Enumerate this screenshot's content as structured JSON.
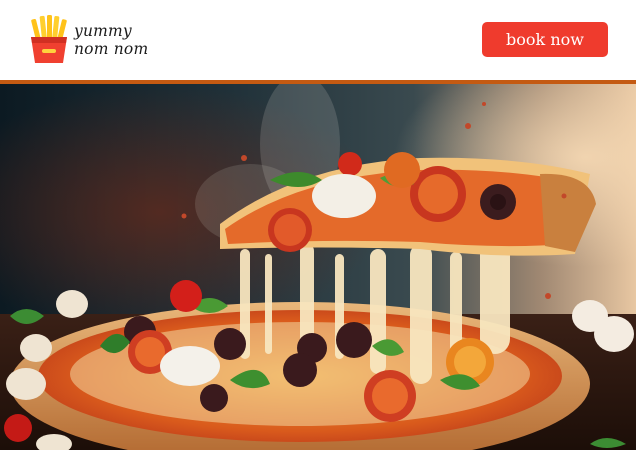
{
  "brand": {
    "logo_icon": "french-fries-icon",
    "line1": "yummy",
    "line2": "nom nom"
  },
  "header": {
    "cta_label": "book now"
  },
  "hero": {
    "image_icon": "pizza-photo"
  },
  "colors": {
    "accent": "#ef3b2d",
    "divider": "#c45a12",
    "text": "#1b1b1b"
  }
}
